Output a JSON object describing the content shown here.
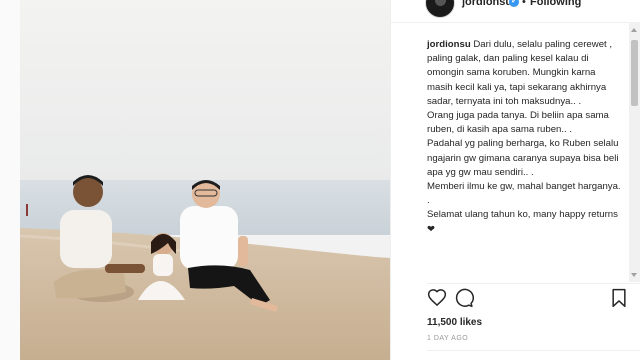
{
  "post": {
    "username": "jordionsu",
    "verified_symbol": "✔",
    "separator": "•",
    "follow_label": "Following",
    "caption_lines": [
      "Dari dulu, selalu paling cerewet , paling galak, dan paling kesel kalau di omongin sama koruben. Mungkin karna masih kecil kali ya, tapi sekarang akhirnya sadar, ternyata ini toh maksudnya.. .",
      "Orang juga pada tanya. Di beliin apa sama ruben, di kasih apa sama ruben.. .",
      "Padahal yg paling berharga, ko Ruben selalu ngajarin gw gimana caranya supaya bisa beli apa yg gw mau sendiri.. .",
      "Memberi ilmu ke gw, mahal banget harganya.",
      ".",
      "Selamat ulang tahun ko, many happy returns ❤"
    ],
    "likes": "11,500 likes",
    "timestamp": "1 DAY AGO"
  },
  "icons": {
    "like": "heart-outline-icon",
    "comment": "speech-bubble-icon",
    "save": "bookmark-icon"
  },
  "colors": {
    "text": "#262626",
    "muted": "#999999",
    "verified": "#3897f0",
    "border": "#efefef"
  }
}
